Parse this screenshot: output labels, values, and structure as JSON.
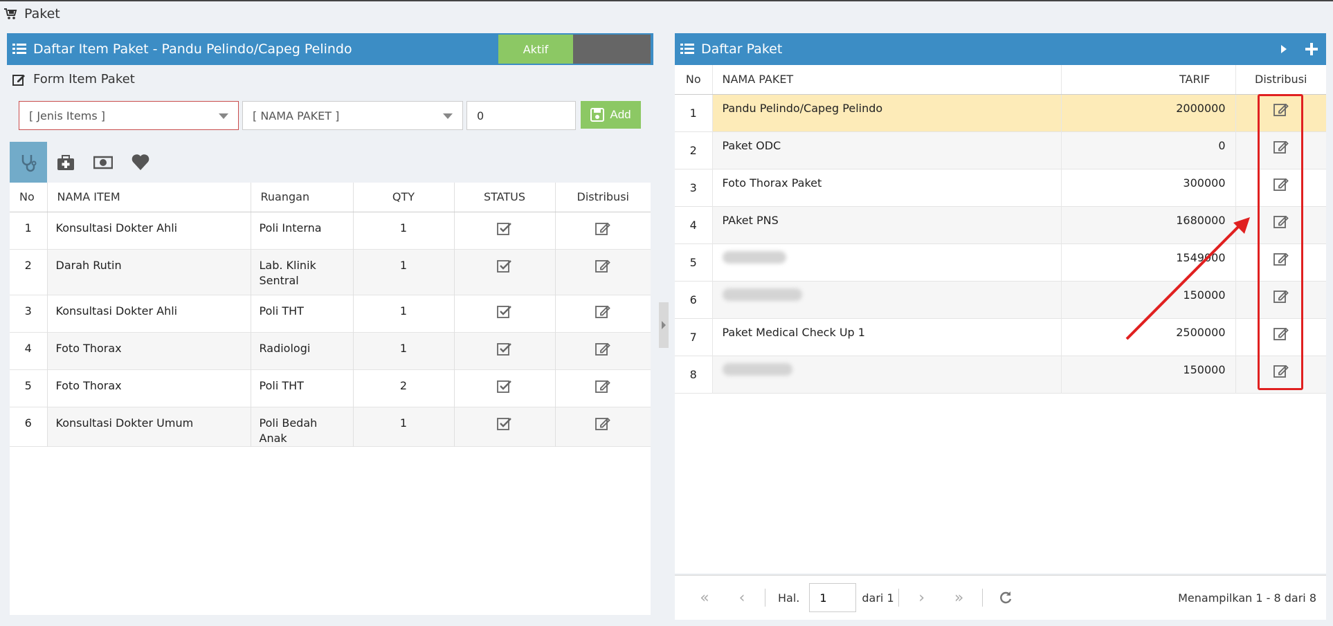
{
  "page": {
    "title": "Paket"
  },
  "left_panel": {
    "title": "Daftar Item Paket - Pandu Pelindo/Capeg Pelindo",
    "toggle_label": "Aktif",
    "form_title": "Form Item Paket",
    "jenis_select": "[ Jenis Items ]",
    "nama_paket_select": "[ NAMA PAKET ]",
    "qty_value": "0",
    "add_label": "Add",
    "columns": [
      "No",
      "NAMA ITEM",
      "Ruangan",
      "QTY",
      "STATUS",
      "Distribusi"
    ],
    "rows": [
      {
        "no": "1",
        "item": "Konsultasi Dokter Ahli",
        "ruangan": "Poli Interna",
        "qty": "1"
      },
      {
        "no": "2",
        "item": "Darah Rutin",
        "ruangan": "Lab. Klinik Sentral",
        "qty": "1"
      },
      {
        "no": "3",
        "item": "Konsultasi Dokter Ahli",
        "ruangan": "Poli THT",
        "qty": "1"
      },
      {
        "no": "4",
        "item": "Foto Thorax",
        "ruangan": "Radiologi",
        "qty": "1"
      },
      {
        "no": "5",
        "item": "Foto Thorax",
        "ruangan": "Poli THT",
        "qty": "2"
      },
      {
        "no": "6",
        "item": "Konsultasi Dokter Umum",
        "ruangan": "Poli Bedah Anak",
        "qty": "1"
      }
    ]
  },
  "right_panel": {
    "title": "Daftar Paket",
    "columns": [
      "No",
      "NAMA PAKET",
      "TARIF",
      "Distribusi"
    ],
    "rows": [
      {
        "no": "1",
        "nama": "Pandu Pelindo/Capeg Pelindo",
        "tarif": "2000000"
      },
      {
        "no": "2",
        "nama": "Paket ODC",
        "tarif": "0"
      },
      {
        "no": "3",
        "nama": "Foto Thorax Paket",
        "tarif": "300000"
      },
      {
        "no": "4",
        "nama": "PAket PNS",
        "tarif": "1680000"
      },
      {
        "no": "5",
        "nama": "",
        "tarif": "1549000"
      },
      {
        "no": "6",
        "nama": "",
        "tarif": "150000"
      },
      {
        "no": "7",
        "nama": "Paket Medical Check Up 1",
        "tarif": "2500000"
      },
      {
        "no": "8",
        "nama": "",
        "tarif": "150000"
      }
    ]
  },
  "pager": {
    "hal_label": "Hal.",
    "page_value": "1",
    "dari_label": "dari 1",
    "info": "Menampilkan 1 - 8 dari 8"
  },
  "colors": {
    "header_blue": "#3c8dc5",
    "active_green": "#8cc864",
    "selected_row": "#fdebb8",
    "annotation_red": "#e02020"
  }
}
